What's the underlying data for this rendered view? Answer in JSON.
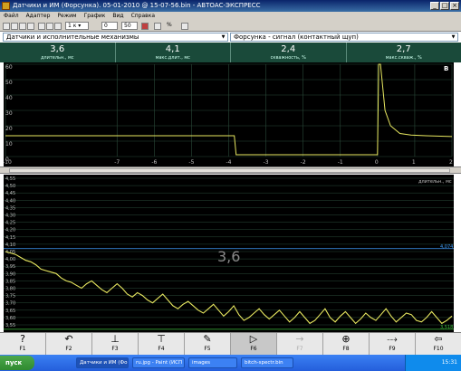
{
  "window": {
    "title": "Датчики и ИМ (Форсунка). 05-01-2010 @ 15-07-56.bin - АВТОАС-ЭКСПРЕСС"
  },
  "menu": [
    "Файл",
    "Адаптер",
    "Режим",
    "График",
    "Вид",
    "Справка"
  ],
  "toolbar": {
    "zoom_value": "0",
    "count_value": "50",
    "percent_label": "%"
  },
  "selectors": {
    "left": "Датчики и исполнительные механизмы",
    "right": "Форсунка - сигнал (контактный щуп)"
  },
  "readouts": [
    {
      "value": "3,6",
      "label": "длительн., мс"
    },
    {
      "value": "4,1",
      "label": "макс.длит., мс"
    },
    {
      "value": "2,4",
      "label": "скважность, %"
    },
    {
      "value": "2,7",
      "label": "макс.скваж., %"
    }
  ],
  "colors": {
    "trace": "#e8e860",
    "grid": "#2a4a3a",
    "axis_text": "#c0c0c0",
    "readout_bg": "#1a4a3a",
    "cursor_hi": "#40a0ff",
    "cursor_lo": "#40c040"
  },
  "chart_data": [
    {
      "type": "line",
      "corner_label": "В",
      "ylim": [
        0,
        60
      ],
      "y_ticks": [
        "60",
        "50",
        "40",
        "30",
        "20",
        "10",
        "0"
      ],
      "x_ticks": [
        "-10",
        "-7",
        "-6",
        "-5",
        "-4",
        "-3",
        "-2",
        "-1",
        "0",
        "1",
        "2"
      ],
      "x_tick_positions": [
        -10,
        -7,
        -6,
        -5,
        -4,
        -3,
        -2,
        -1,
        0,
        1,
        2
      ],
      "xlim": [
        -10,
        2
      ],
      "series": [
        {
          "x": [
            -10,
            -5,
            -3.85,
            -3.8,
            -1,
            0,
            0.03,
            0.08,
            0.2,
            0.35,
            0.6,
            0.9,
            1.3,
            2
          ],
          "y": [
            13.5,
            13.5,
            13.5,
            1.2,
            1.2,
            1.2,
            60,
            60,
            30,
            20,
            15,
            14,
            13.5,
            13
          ]
        }
      ]
    },
    {
      "type": "line",
      "corner_label": "длительн., мс",
      "big_label": "3,6",
      "ylim": [
        3.5,
        4.1
      ],
      "y_ticks": [
        "4,55",
        "4,50",
        "4,45",
        "4,40",
        "4,35",
        "4,30",
        "4,25",
        "4,20",
        "4,15",
        "4,10",
        "4,05",
        "4,00",
        "3,95",
        "3,90",
        "3,85",
        "3,80",
        "3,75",
        "3,70",
        "3,65",
        "3,60",
        "3,55"
      ],
      "cursors": [
        {
          "value": 4.07,
          "label": "4,074"
        },
        {
          "value": 3.52,
          "label": "3,518"
        }
      ],
      "series": [
        {
          "values": [
            4.05,
            4.04,
            4.03,
            4.01,
            3.99,
            3.98,
            3.96,
            3.93,
            3.92,
            3.91,
            3.9,
            3.87,
            3.85,
            3.84,
            3.82,
            3.8,
            3.83,
            3.85,
            3.82,
            3.79,
            3.77,
            3.8,
            3.83,
            3.8,
            3.76,
            3.74,
            3.77,
            3.75,
            3.72,
            3.7,
            3.73,
            3.76,
            3.72,
            3.68,
            3.66,
            3.69,
            3.71,
            3.68,
            3.65,
            3.63,
            3.66,
            3.69,
            3.65,
            3.61,
            3.64,
            3.68,
            3.62,
            3.58,
            3.6,
            3.63,
            3.66,
            3.62,
            3.59,
            3.62,
            3.65,
            3.61,
            3.57,
            3.6,
            3.64,
            3.6,
            3.56,
            3.58,
            3.62,
            3.66,
            3.6,
            3.57,
            3.61,
            3.64,
            3.6,
            3.56,
            3.59,
            3.63,
            3.6,
            3.58,
            3.62,
            3.66,
            3.61,
            3.57,
            3.6,
            3.63,
            3.62,
            3.58,
            3.57,
            3.6,
            3.64,
            3.6,
            3.56,
            3.58,
            3.61
          ]
        }
      ]
    }
  ],
  "fkeys": [
    {
      "icon": "?",
      "label": "F1",
      "name": "help"
    },
    {
      "icon": "↶",
      "label": "F2",
      "name": "trace"
    },
    {
      "icon": "⊥",
      "label": "F3",
      "name": "axis-x"
    },
    {
      "icon": "⊤",
      "label": "F4",
      "name": "axis-y"
    },
    {
      "icon": "✎",
      "label": "F5",
      "name": "draw"
    },
    {
      "icon": "▷",
      "label": "F6",
      "name": "play"
    },
    {
      "icon": "→",
      "label": "F7",
      "name": "next"
    },
    {
      "icon": "⊕",
      "label": "F8",
      "name": "target"
    },
    {
      "icon": "⤏",
      "label": "F9",
      "name": "probe"
    },
    {
      "icon": "⇦",
      "label": "F10",
      "name": "exit"
    }
  ],
  "taskbar": {
    "start": "пуск",
    "tasks": [
      "Датчики и ИМ (Фор...",
      "ru.jpg - Paint (ИСП а...",
      "images",
      "bitch-spectr.bin"
    ],
    "clock": "15:31"
  }
}
